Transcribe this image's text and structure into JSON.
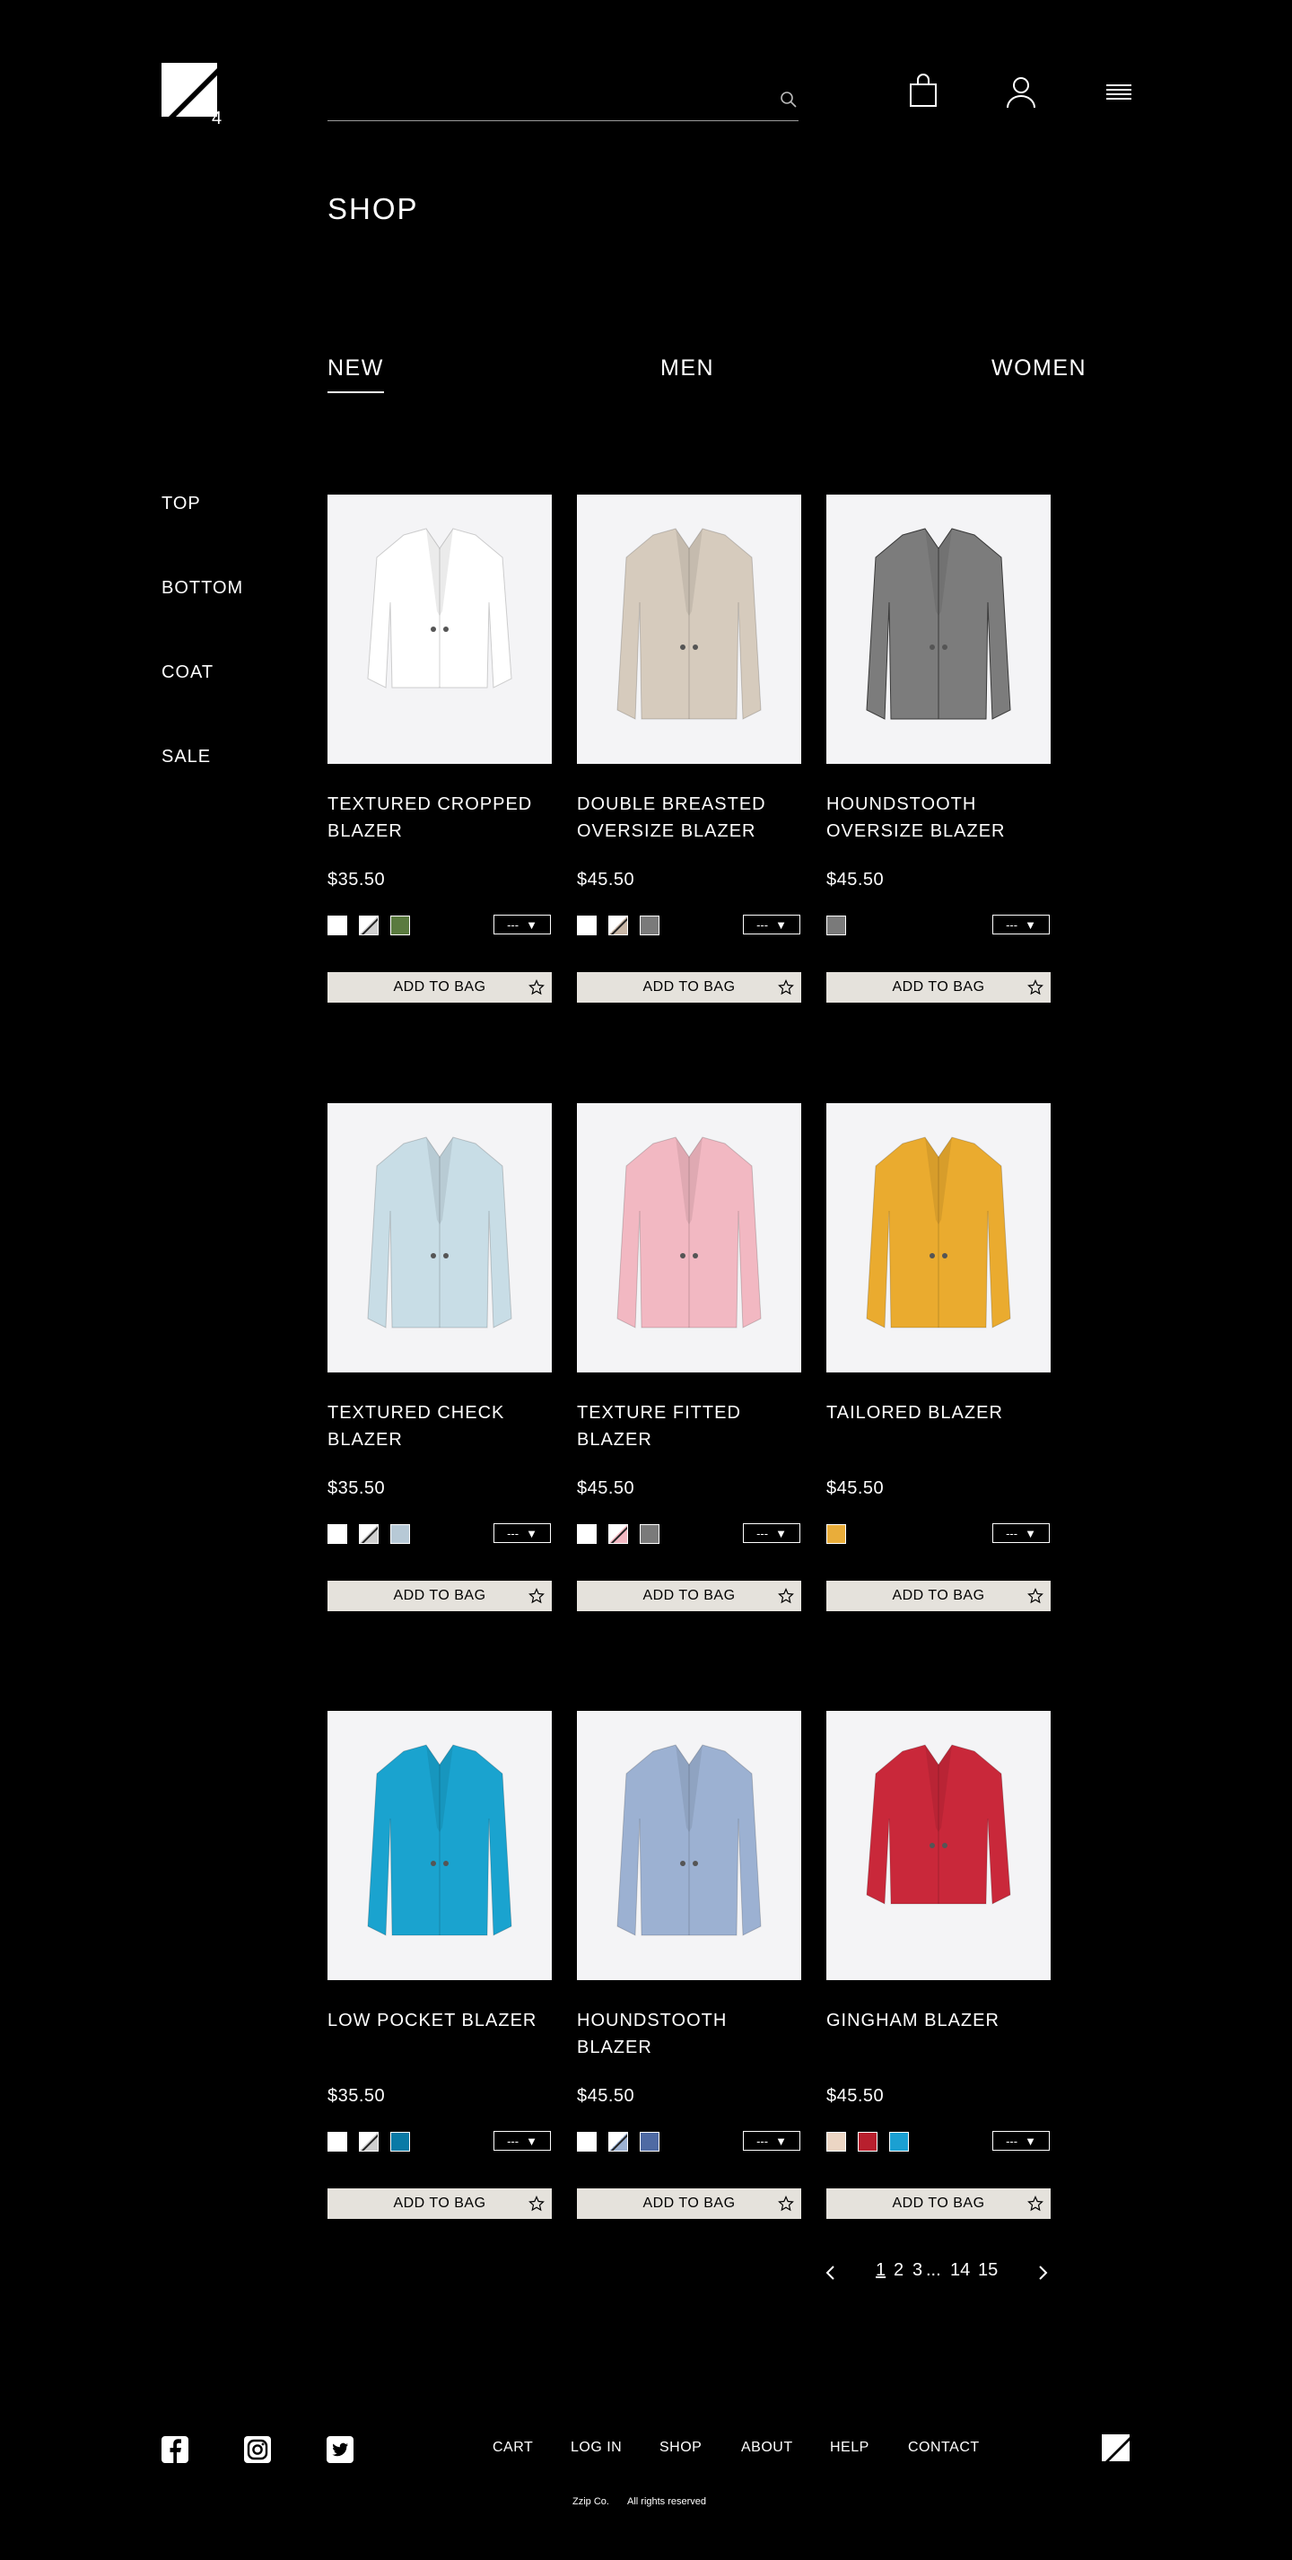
{
  "header": {
    "logo_icon": "brand-logo-icon",
    "search": {
      "value": "",
      "placeholder": "",
      "icon": "search-icon"
    },
    "icons": [
      "shopping-bag-icon",
      "user-icon",
      "menu-icon"
    ]
  },
  "page": {
    "title": "SHOP"
  },
  "tabs": [
    {
      "label": "NEW",
      "active": true
    },
    {
      "label": "MEN",
      "active": false
    },
    {
      "label": "WOMEN",
      "active": false
    }
  ],
  "sidebar": {
    "items": [
      "TOP",
      "BOTTOM",
      "COAT",
      "SALE"
    ]
  },
  "products": [
    {
      "name": "TEXTURED CROPPED BLAZER",
      "price": "$35.50",
      "swatches": [
        "#ffffff",
        "split",
        "#5a7a3f"
      ],
      "size": "---",
      "button": "ADD TO BAG",
      "color": "#ffffff"
    },
    {
      "name": "DOUBLE BREASTED OVERSIZE BLAZER",
      "price": "$45.50",
      "swatches": [
        "#ffffff",
        "split-beige",
        "#7a7a7a"
      ],
      "size": "---",
      "button": "ADD TO BAG",
      "color": "#d6cbbd"
    },
    {
      "name": "HOUNDSTOOTH OVERSIZE BLAZER",
      "price": "$45.50",
      "swatches": [
        "#7a7a7a"
      ],
      "size": "---",
      "button": "ADD TO BAG",
      "color": "#7c7c7c"
    },
    {
      "name": "TEXTURED CHECK BLAZER",
      "price": "$35.50",
      "swatches": [
        "#ffffff",
        "split",
        "#b7c9d6"
      ],
      "size": "---",
      "button": "ADD TO BAG",
      "color": "#c8dde6"
    },
    {
      "name": "TEXTURE FITTED BLAZER",
      "price": "$45.50",
      "swatches": [
        "#ffffff",
        "split-pink",
        "#7a7a7a"
      ],
      "size": "---",
      "button": "ADD TO BAG",
      "color": "#f2b8c2"
    },
    {
      "name": "TAILORED BLAZER",
      "price": "$45.50",
      "swatches": [
        "#e9ad3a"
      ],
      "size": "---",
      "button": "ADD TO BAG",
      "color": "#eaab2f"
    },
    {
      "name": "LOW POCKET BLAZER",
      "price": "$35.50",
      "swatches": [
        "#ffffff",
        "split",
        "#0a7aa6"
      ],
      "size": "---",
      "button": "ADD TO BAG",
      "color": "#1aa3cf"
    },
    {
      "name": "HOUNDSTOOTH BLAZER",
      "price": "$45.50",
      "swatches": [
        "#ffffff",
        "split-blue",
        "#4f6aa3"
      ],
      "size": "---",
      "button": "ADD TO BAG",
      "color": "#9cb1d2"
    },
    {
      "name": "GINGHAM BLAZER",
      "price": "$45.50",
      "swatches": [
        "#ecd6c4",
        "#b8202e",
        "#1ba0d2"
      ],
      "size": "---",
      "button": "ADD TO BAG",
      "color": "#c9283a"
    }
  ],
  "pagination": {
    "prev_icon": "chevron-left-icon",
    "next_icon": "chevron-right-icon",
    "pages": [
      "1",
      "2",
      "3",
      "...",
      "14",
      "15"
    ],
    "current": "1"
  },
  "footer": {
    "social_icons": [
      "facebook-icon",
      "instagram-icon",
      "twitter-icon"
    ],
    "links": [
      "CART",
      "LOG IN",
      "SHOP",
      "ABOUT",
      "HELP",
      "CONTACT"
    ],
    "company": "Zzip Co.",
    "rights": "All rights reserved"
  },
  "colors": {
    "background": "#000000",
    "button_bg": "#e5e2dc",
    "image_bg": "#f4f4f6"
  }
}
